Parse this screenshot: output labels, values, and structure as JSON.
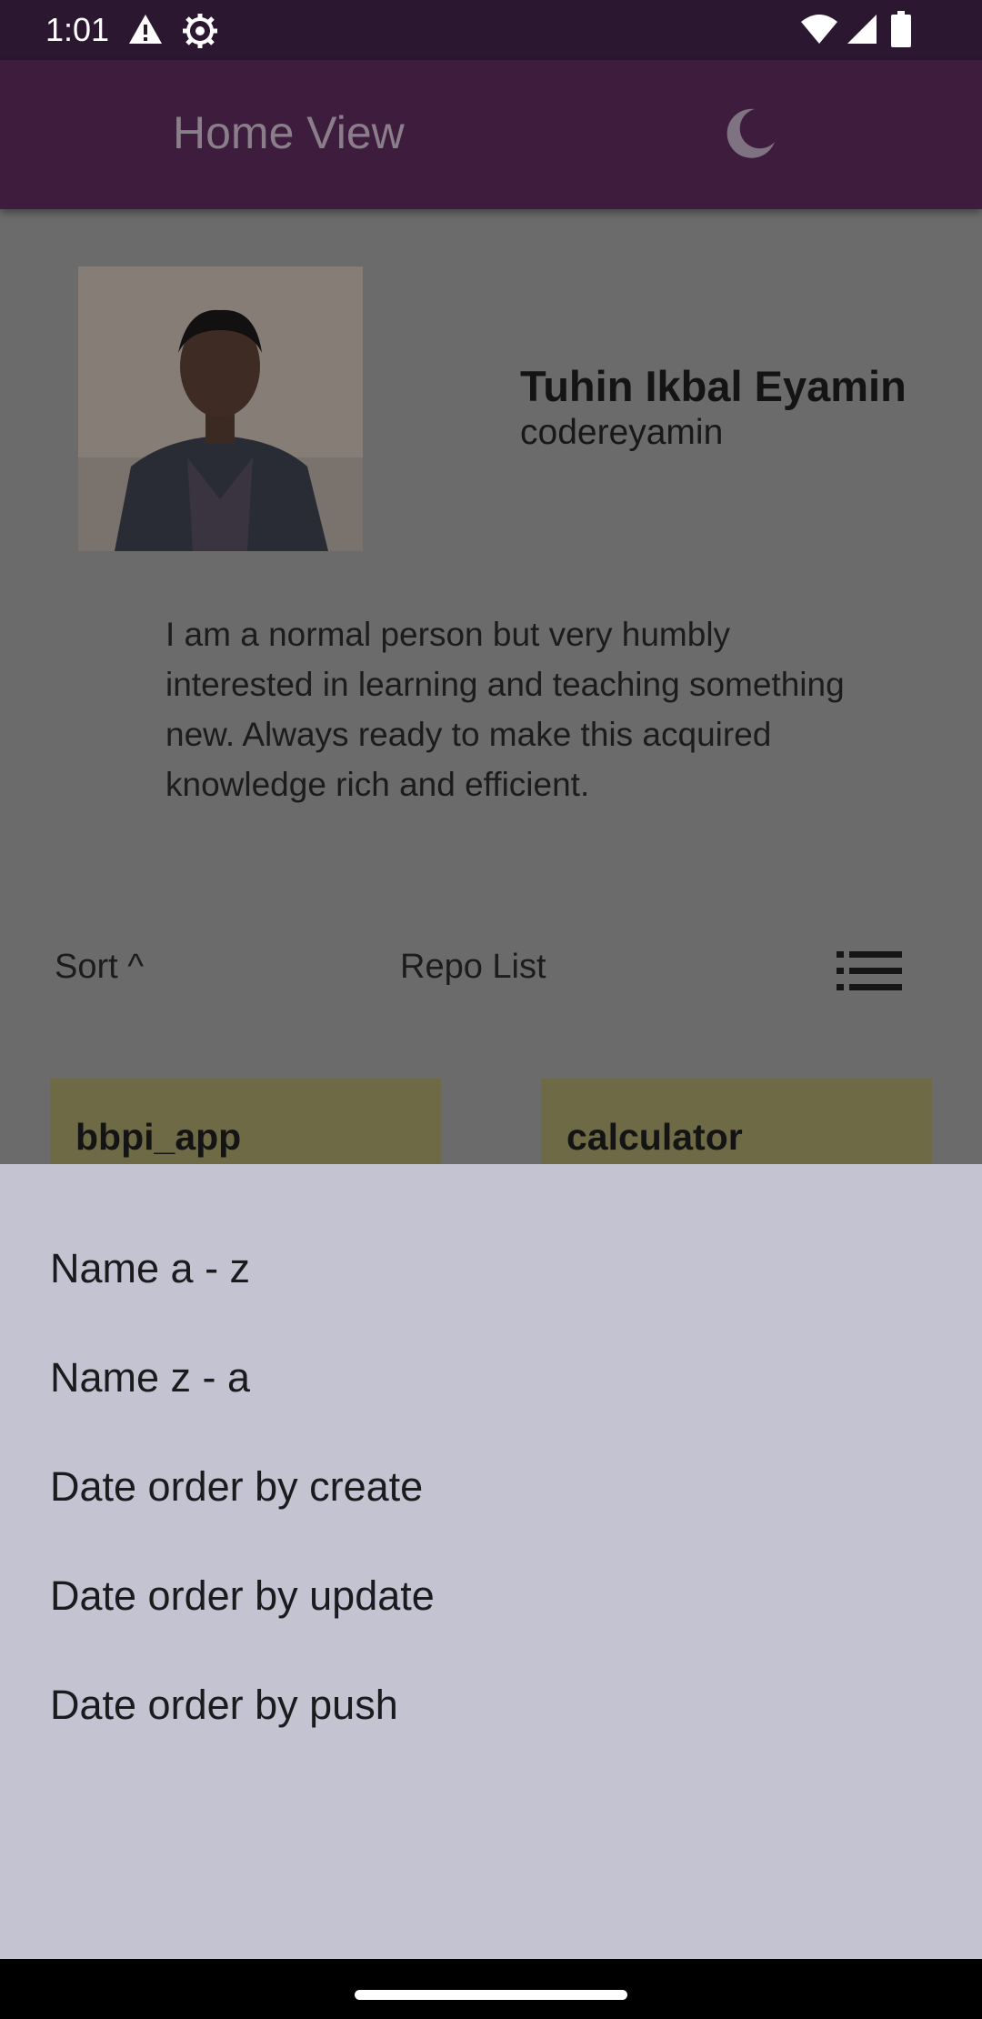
{
  "status_bar": {
    "time": "1:01",
    "icons": [
      "warning-icon",
      "gear-icon",
      "wifi-icon",
      "signal-icon",
      "battery-icon"
    ]
  },
  "app_bar": {
    "title": "Home View",
    "theme_icon": "moon-icon"
  },
  "profile": {
    "name": "Tuhin Ikbal Eyamin",
    "username": "codereyamin",
    "bio": "I am a normal person but very humbly interested in learning and teaching something new. Always ready to make this acquired knowledge rich and efficient."
  },
  "repo_header": {
    "sort_label": "Sort ^",
    "title": "Repo List",
    "view_icon": "list-icon"
  },
  "repos": [
    {
      "name": "bbpi_app"
    },
    {
      "name": "calculator"
    }
  ],
  "sort_sheet": {
    "options": [
      "Name a - z",
      "Name z - a",
      "Date order by create",
      "Date order by update",
      "Date order by push"
    ]
  },
  "colors": {
    "status_bar_bg": "#2b1730",
    "app_bar_bg": "#3d1c3d",
    "scrim_bg": "#6b6b6b",
    "repo_card_bg": "#6e6a46",
    "sheet_bg": "#c4c3d1"
  }
}
